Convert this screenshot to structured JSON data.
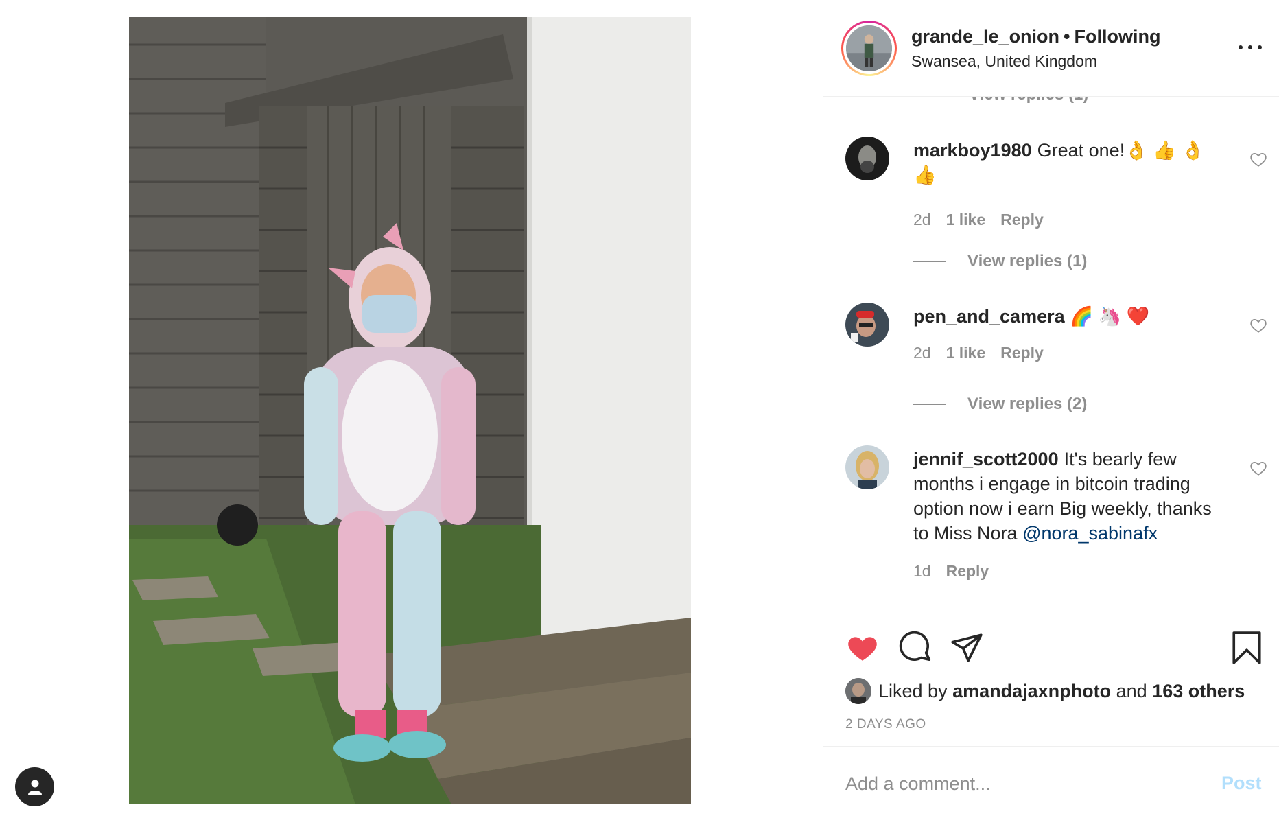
{
  "post": {
    "owner_username": "grande_le_onion",
    "follow_status": "Following",
    "separator": "•",
    "location": "Swansea, United Kingdom",
    "cut_off_text": "View replies (1)"
  },
  "comments": [
    {
      "username": "markboy1980",
      "text": "Great one!👌 👍 👌 👍",
      "age": "2d",
      "likes": "1 like",
      "reply_label": "Reply",
      "view_replies": "View replies (1)"
    },
    {
      "username": "pen_and_camera",
      "text": "🌈 🦄 ❤️",
      "age": "2d",
      "likes": "1 like",
      "reply_label": "Reply",
      "view_replies": "View replies (2)"
    },
    {
      "username": "jennif_scott2000",
      "text": "It's bearly few months i engage in bitcoin trading option now i earn Big weekly, thanks to Miss Nora",
      "mention": "@nora_sabinafx",
      "age": "1d",
      "reply_label": "Reply"
    }
  ],
  "likes": {
    "prefix": "Liked by",
    "user": "amandajaxnphoto",
    "middle": "and",
    "others": "163 others"
  },
  "timestamp": "2 DAYS AGO",
  "comment_box": {
    "placeholder": "Add a comment...",
    "post_label": "Post"
  },
  "colors": {
    "liked_heart": "#ed4956",
    "link": "#00376b",
    "muted": "#8e8e8e",
    "post_disabled": "#b2dffc"
  },
  "icons": [
    "heart-icon",
    "comment-icon",
    "share-icon",
    "bookmark-icon",
    "more-icon",
    "profile-icon"
  ]
}
